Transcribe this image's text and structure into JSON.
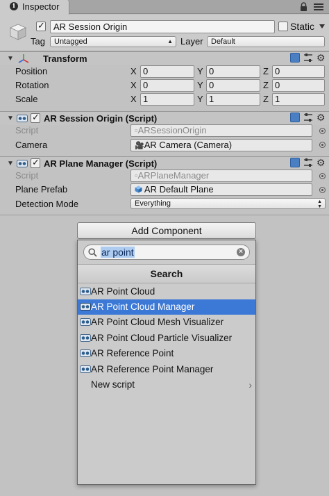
{
  "tab": {
    "title": "Inspector"
  },
  "header": {
    "object_name": "AR Session Origin",
    "static_label": "Static",
    "tag_label": "Tag",
    "tag_value": "Untagged",
    "layer_label": "Layer",
    "layer_value": "Default"
  },
  "transform": {
    "title": "Transform",
    "rows": [
      {
        "label": "Position",
        "x": "0",
        "y": "0",
        "z": "0"
      },
      {
        "label": "Rotation",
        "x": "0",
        "y": "0",
        "z": "0"
      },
      {
        "label": "Scale",
        "x": "1",
        "y": "1",
        "z": "1"
      }
    ],
    "axes": {
      "x": "X",
      "y": "Y",
      "z": "Z"
    }
  },
  "session_origin": {
    "title": "AR Session Origin (Script)",
    "script_label": "Script",
    "script_value": "ARSessionOrigin",
    "camera_label": "Camera",
    "camera_value": "AR Camera (Camera)"
  },
  "plane_manager": {
    "title": "AR Plane Manager (Script)",
    "script_label": "Script",
    "script_value": "ARPlaneManager",
    "prefab_label": "Plane Prefab",
    "prefab_value": "AR Default Plane",
    "detection_label": "Detection Mode",
    "detection_value": "Everything"
  },
  "add_component": {
    "button_label": "Add Component",
    "search_query": "ar point",
    "search_title": "Search",
    "items": [
      {
        "label": "AR Point Cloud"
      },
      {
        "label": "AR Point Cloud Manager"
      },
      {
        "label": "AR Point Cloud Mesh Visualizer"
      },
      {
        "label": "AR Point Cloud Particle Visualizer"
      },
      {
        "label": "AR Reference Point"
      },
      {
        "label": "AR Reference Point Manager"
      },
      {
        "label": "New script"
      }
    ]
  },
  "colors": {
    "selection": "#3c79d6",
    "panel": "#c2c2c2",
    "header": "#cbcbcb"
  }
}
